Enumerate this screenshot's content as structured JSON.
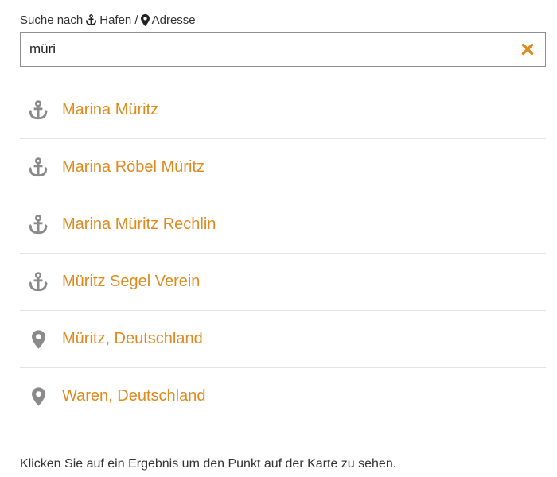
{
  "search": {
    "label_prefix": "Suche nach",
    "label_harbor": "Hafen /",
    "label_address": "Adresse",
    "value": "müri",
    "placeholder": ""
  },
  "colors": {
    "accent": "#e08a1e",
    "icon_gray": "#8a8a8a",
    "text": "#333333"
  },
  "results": [
    {
      "icon": "anchor-icon",
      "label": "Marina Müritz"
    },
    {
      "icon": "anchor-icon",
      "label": "Marina Röbel Müritz"
    },
    {
      "icon": "anchor-icon",
      "label": "Marina Müritz Rechlin"
    },
    {
      "icon": "anchor-icon",
      "label": "Müritz Segel Verein"
    },
    {
      "icon": "map-marker-icon",
      "label": "Müritz, Deutschland"
    },
    {
      "icon": "map-marker-icon",
      "label": "Waren, Deutschland"
    }
  ],
  "footer": {
    "hint": "Klicken Sie auf ein Ergebnis um den Punkt auf der Karte zu sehen."
  }
}
